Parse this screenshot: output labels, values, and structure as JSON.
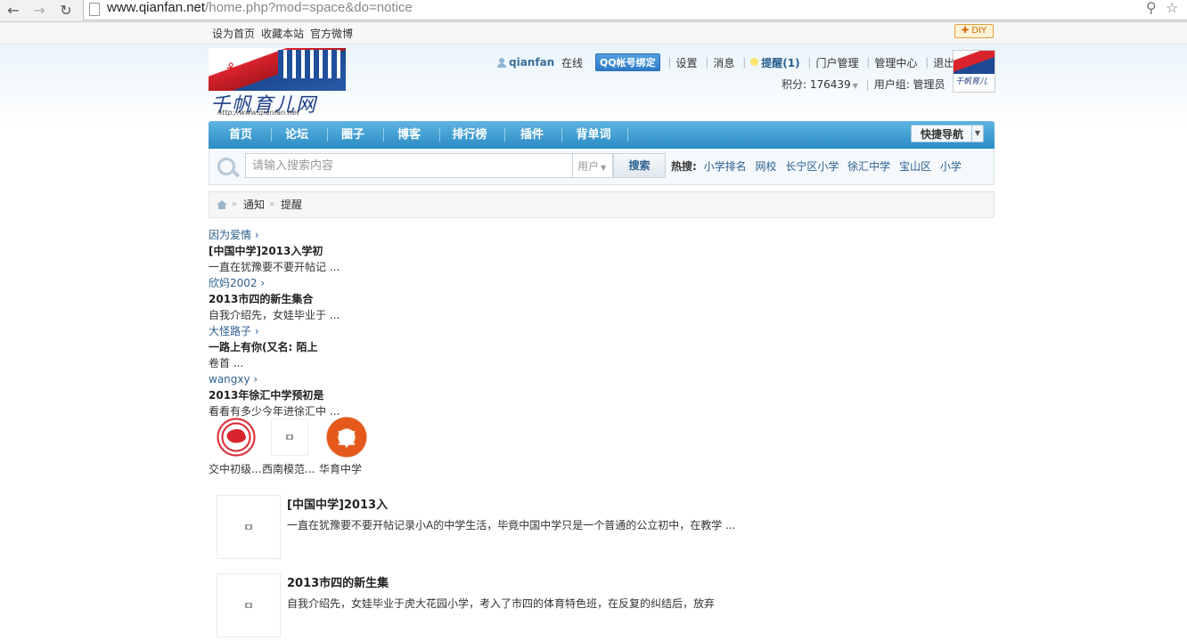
{
  "browser": {
    "url_host": "www.qianfan.net",
    "url_path": "/home.php?mod=space&do=notice",
    "back_icon": "arrow-left-icon",
    "forward_icon": "arrow-right-icon",
    "reload_icon": "reload-icon"
  },
  "topbar": {
    "links": [
      "设为首页",
      "收藏本站",
      "官方微博"
    ],
    "diy_label": "✚ DIY"
  },
  "header": {
    "logo_name": "千帆育儿网",
    "logo_url": "http://www.qianfan.net",
    "user": {
      "name": "qianfan",
      "online": "在线",
      "qq_bind": "QQ帐号绑定",
      "settings": "设置",
      "messages": "消息",
      "remind": "提醒(1)",
      "portal": "门户管理",
      "admin": "管理中心",
      "logout": "退出",
      "points_label": "积分: 176439",
      "usergroup_label": "用户组: 管理员"
    }
  },
  "nav": {
    "items": [
      "首页",
      "论坛",
      "圈子",
      "博客",
      "排行榜",
      "插件",
      "背单词"
    ],
    "quick_nav": "快捷导航"
  },
  "search": {
    "placeholder": "请输入搜索内容",
    "type": "用户",
    "button": "搜索",
    "hot_label": "热搜:",
    "hot_keywords": [
      "小学排名",
      "网校",
      "长宁区小学",
      "徐汇中学",
      "宝山区",
      "小学"
    ]
  },
  "breadcrumb": {
    "items": [
      "通知",
      "提醒"
    ]
  },
  "notices": [
    {
      "author": "因为爱情 ›",
      "title": "[中国中学]2013入学初",
      "summary": "一直在犹豫要不要开帖记 ..."
    },
    {
      "author": "欣妈2002 ›",
      "title": "2013市四的新生集合",
      "summary": "自我介绍先，女娃毕业于 ..."
    },
    {
      "author": "大怪路子 ›",
      "title": "一路上有你(又名: 陌上",
      "summary": "卷首 ..."
    },
    {
      "author": "wangxy ›",
      "title": "2013年徐汇中学预初是",
      "summary": "看看有多少今年进徐汇中 ..."
    }
  ],
  "thumbs": [
    {
      "caption": "交中初级...",
      "icon": "school-seal-icon"
    },
    {
      "caption": "西南模范...",
      "icon": "camera-placeholder-icon"
    },
    {
      "caption": "华育中学",
      "icon": "school-badge-icon"
    }
  ],
  "articles": [
    {
      "title": "[中国中学]2013入",
      "summary": "一直在犹豫要不要开帖记录小A的中学生活，毕竟中国中学只是一个普通的公立初中，在教学 ..."
    },
    {
      "title": "2013市四的新生集",
      "summary": "自我介绍先，女娃毕业于虎大花园小学，考入了市四的体育特色班，在反复的纠结后，放弃"
    }
  ]
}
